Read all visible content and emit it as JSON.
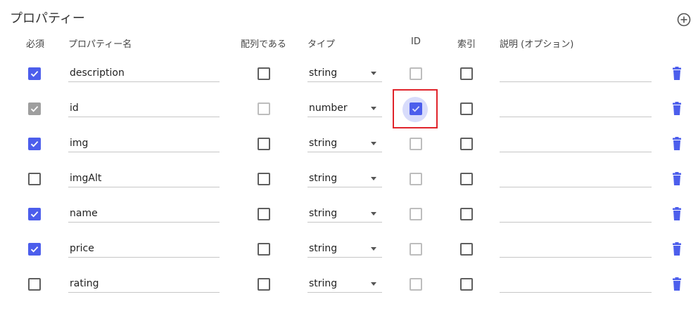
{
  "header": {
    "title": "プロパティー",
    "add_icon": "add-circle-icon"
  },
  "columns": {
    "required": "必須",
    "name": "プロパティー名",
    "is_array": "配列である",
    "type": "タイプ",
    "id": "ID",
    "index": "索引",
    "description": "説明 (オプション)"
  },
  "rows": [
    {
      "required": "checked",
      "name": "description",
      "is_array": "unchecked",
      "type": "string",
      "id": "disabled",
      "index": "unchecked",
      "description": ""
    },
    {
      "required": "checked-disabled",
      "name": "id",
      "is_array": "disabled",
      "type": "number",
      "id": "checked",
      "index": "unchecked",
      "description": ""
    },
    {
      "required": "checked",
      "name": "img",
      "is_array": "unchecked",
      "type": "string",
      "id": "disabled",
      "index": "unchecked",
      "description": ""
    },
    {
      "required": "unchecked",
      "name": "imgAlt",
      "is_array": "unchecked",
      "type": "string",
      "id": "disabled",
      "index": "unchecked",
      "description": ""
    },
    {
      "required": "checked",
      "name": "name",
      "is_array": "unchecked",
      "type": "string",
      "id": "disabled",
      "index": "unchecked",
      "description": ""
    },
    {
      "required": "checked",
      "name": "price",
      "is_array": "unchecked",
      "type": "string",
      "id": "disabled",
      "index": "unchecked",
      "description": ""
    },
    {
      "required": "unchecked",
      "name": "rating",
      "is_array": "unchecked",
      "type": "string",
      "id": "disabled",
      "index": "unchecked",
      "description": ""
    }
  ],
  "icons": {
    "delete": "trash-icon",
    "dropdown": "caret-down-icon",
    "check": "check-icon"
  },
  "colors": {
    "accent": "#4c5eec",
    "disabled": "#9e9e9e",
    "highlight": "#e0242b",
    "delete": "#4c5eec"
  }
}
